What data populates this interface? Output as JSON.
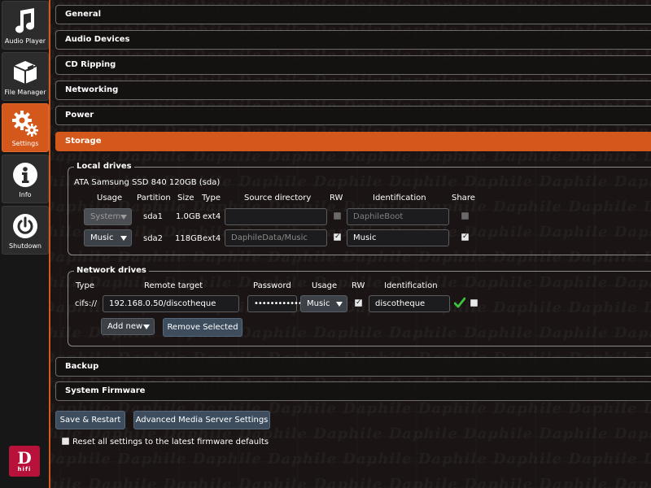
{
  "sidebar": {
    "items": [
      {
        "label": "Audio Player",
        "icon": "music-note-icon"
      },
      {
        "label": "File Manager",
        "icon": "box-icon"
      },
      {
        "label": "Settings",
        "icon": "gears-icon",
        "active": true
      },
      {
        "label": "Info",
        "icon": "info-icon"
      },
      {
        "label": "Shutdown",
        "icon": "power-icon"
      }
    ],
    "logo_letter": "D",
    "logo_sub": "hifi"
  },
  "watermark": "Daphile",
  "sections": {
    "general": "General",
    "audio_devices": "Audio Devices",
    "cd_ripping": "CD Ripping",
    "networking": "Networking",
    "power": "Power",
    "storage": "Storage",
    "backup": "Backup",
    "system_firmware": "System Firmware"
  },
  "local_drives": {
    "legend": "Local drives",
    "disk_name": "ATA Samsung SSD 840 120GB (sda)",
    "headers": {
      "usage": "Usage",
      "partition": "Partition",
      "size": "Size",
      "type": "Type",
      "source_directory": "Source directory",
      "rw": "RW",
      "identification": "Identification",
      "share": "Share"
    },
    "rows": [
      {
        "usage": "System",
        "partition": "sda1",
        "size": "1.0GB",
        "type": "ext4",
        "source": "",
        "source_placeholder": "",
        "rw": false,
        "identification": "DaphileBoot",
        "share": false
      },
      {
        "usage": "Music",
        "partition": "sda2",
        "size": "118GB",
        "type": "ext4",
        "source": "",
        "source_placeholder": "DaphileData/Music",
        "rw": true,
        "identification": "Music",
        "share": true
      }
    ]
  },
  "network_drives": {
    "legend": "Network drives",
    "headers": {
      "type": "Type",
      "remote_target": "Remote target",
      "password": "Password",
      "usage": "Usage",
      "rw": "RW",
      "identification": "Identification"
    },
    "row": {
      "type": "cifs://",
      "remote_target": "192.168.0.50/discotheque",
      "password": "••••••••••••",
      "usage": "Music",
      "rw": true,
      "identification": "discotheque",
      "share": false,
      "status_icon": "check-icon"
    },
    "add_new_label": "Add new",
    "remove_selected_label": "Remove Selected"
  },
  "actions": {
    "save_restart": "Save & Restart",
    "advanced": "Advanced Media Server Settings",
    "reset_label": "Reset all settings to the latest firmware defaults",
    "reset_checked": false
  },
  "colors": {
    "accent": "#d4581b",
    "button": "#3d4d5d",
    "ok": "#3cc23c",
    "logo": "#b8123a"
  }
}
